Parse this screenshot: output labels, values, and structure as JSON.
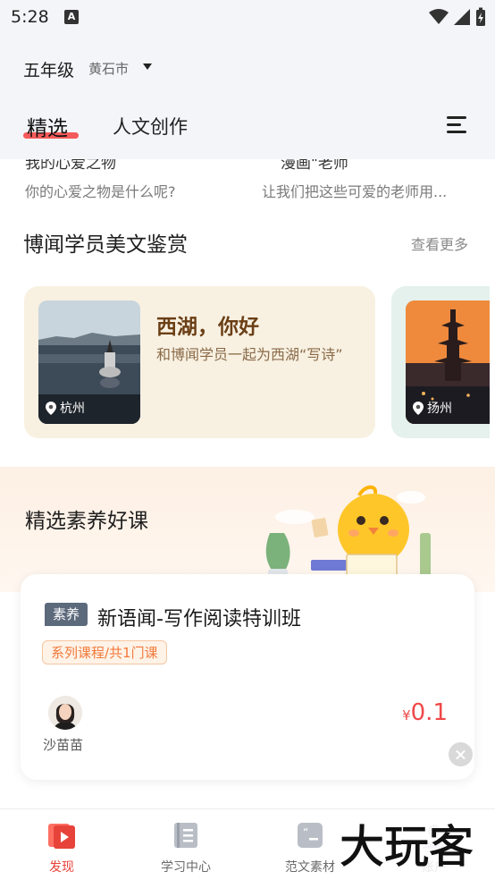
{
  "status_bar": {
    "time": "5:28",
    "notification_icon": "text-a-icon"
  },
  "header": {
    "grade": "五年级",
    "city": "黄石市",
    "tabs": [
      {
        "label": "精选"
      },
      {
        "label": "人文创作"
      }
    ]
  },
  "articles_cutoff": [
    {
      "title": "我的心爱之物",
      "subtitle": "你的心爱之物是什么呢?"
    },
    {
      "title": "漫画\"老师",
      "subtitle": "让我们把这些可爱的老师用..."
    }
  ],
  "appreciation": {
    "title": "博闻学员美文鉴赏",
    "see_more": "查看更多",
    "cards": [
      {
        "title": "西湖，你好",
        "desc": "和博闻学员一起为西湖“写诗”",
        "location": "杭州"
      },
      {
        "location": "扬州"
      }
    ]
  },
  "courses": {
    "title": "精选素养好课",
    "card": {
      "tag": "素养",
      "title": "新语闻-写作阅读特训班",
      "series": "系列课程/共1门课",
      "teacher": "沙苗苗",
      "price_currency": "¥",
      "price": "0.1"
    }
  },
  "bottom_nav": [
    {
      "label": "发现",
      "icon": "discover-play-icon",
      "active": true
    },
    {
      "label": "学习中心",
      "icon": "notebook-icon",
      "active": false
    },
    {
      "label": "范文素材",
      "icon": "quote-doc-icon",
      "active": false
    },
    {
      "label": "账户",
      "icon": "user-icon",
      "active": false
    }
  ],
  "watermark": "大玩客",
  "colors": {
    "accent_red": "#e8433a",
    "tab_underline": "#f55a5a",
    "price": "#f04848",
    "badge_orange": "#f07a3b"
  }
}
